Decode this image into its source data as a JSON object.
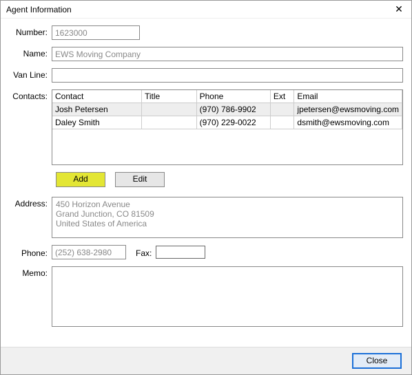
{
  "window": {
    "title": "Agent Information"
  },
  "labels": {
    "number": "Number:",
    "name": "Name:",
    "vanline": "Van Line:",
    "contacts": "Contacts:",
    "address": "Address:",
    "phone": "Phone:",
    "fax": "Fax:",
    "memo": "Memo:"
  },
  "fields": {
    "number": "1623000",
    "name": "EWS Moving Company",
    "vanline": "",
    "phone": "(252) 638-2980",
    "fax": "",
    "address": "450 Horizon Avenue\nGrand Junction, CO 81509\nUnited States of America",
    "memo": ""
  },
  "contacts": {
    "headers": {
      "contact": "Contact",
      "title": "Title",
      "phone": "Phone",
      "ext": "Ext",
      "email": "Email"
    },
    "rows": [
      {
        "selected": true,
        "contact": "Josh Petersen",
        "title": "",
        "phone": "(970) 786-9902",
        "ext": "",
        "email": "jpetersen@ewsmoving.com"
      },
      {
        "selected": false,
        "contact": "Daley Smith",
        "title": "",
        "phone": "(970) 229-0022",
        "ext": "",
        "email": "dsmith@ewsmoving.com"
      }
    ]
  },
  "buttons": {
    "add": "Add",
    "edit": "Edit",
    "close": "Close"
  }
}
